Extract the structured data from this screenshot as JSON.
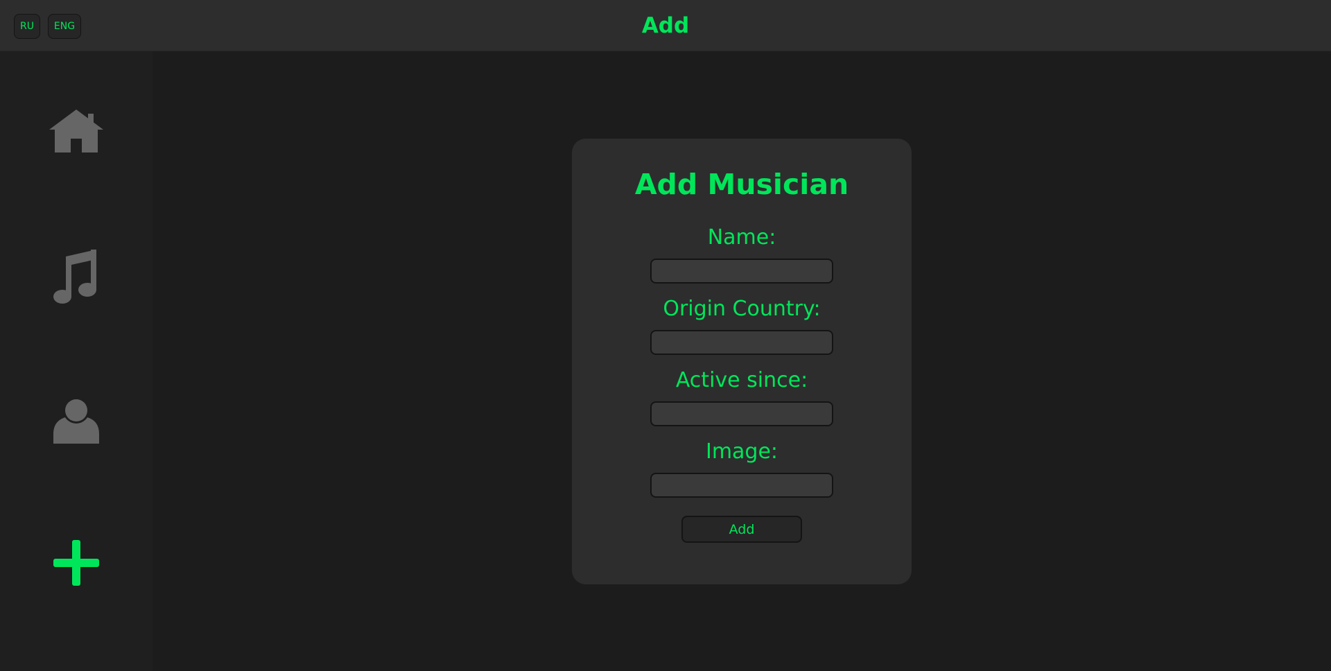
{
  "header": {
    "title": "Add",
    "languages": [
      "RU",
      "ENG"
    ]
  },
  "sidebar": {
    "items": [
      {
        "icon": "home-icon",
        "color": "#666666"
      },
      {
        "icon": "music-note-icon",
        "color": "#666666"
      },
      {
        "icon": "user-icon",
        "color": "#666666"
      },
      {
        "icon": "plus-icon",
        "color": "#00e65a",
        "active": true
      }
    ]
  },
  "form": {
    "title": "Add Musician",
    "fields": [
      {
        "label": "Name:",
        "value": ""
      },
      {
        "label": "Origin Country:",
        "value": ""
      },
      {
        "label": "Active since:",
        "value": ""
      },
      {
        "label": "Image:",
        "value": ""
      }
    ],
    "submit_label": "Add"
  },
  "colors": {
    "accent": "#00e65a",
    "icon_inactive": "#666666",
    "background": "#1c1c1c",
    "panel": "#2d2d2d"
  }
}
